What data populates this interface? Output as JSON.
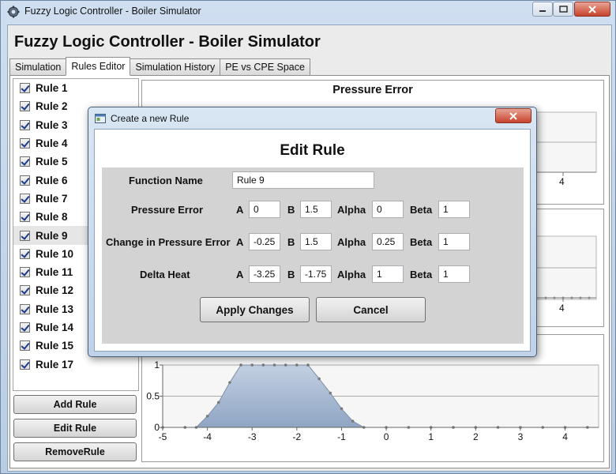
{
  "window": {
    "title": "Fuzzy Logic Controller - Boiler Simulator"
  },
  "app": {
    "header": "Fuzzy Logic Controller - Boiler Simulator"
  },
  "tabs": [
    {
      "label": "Simulation"
    },
    {
      "label": "Rules Editor"
    },
    {
      "label": "Simulation History"
    },
    {
      "label": "PE vs CPE Space"
    }
  ],
  "rules": [
    {
      "label": "Rule 1",
      "checked": true
    },
    {
      "label": "Rule 2",
      "checked": true
    },
    {
      "label": "Rule 3",
      "checked": true
    },
    {
      "label": "Rule 4",
      "checked": true
    },
    {
      "label": "Rule 5",
      "checked": true
    },
    {
      "label": "Rule 6",
      "checked": true
    },
    {
      "label": "Rule 7",
      "checked": true
    },
    {
      "label": "Rule 8",
      "checked": true
    },
    {
      "label": "Rule 9",
      "checked": true,
      "selected": true
    },
    {
      "label": "Rule 10",
      "checked": true
    },
    {
      "label": "Rule 11",
      "checked": true
    },
    {
      "label": "Rule 12",
      "checked": true
    },
    {
      "label": "Rule 13",
      "checked": true
    },
    {
      "label": "Rule 14",
      "checked": true
    },
    {
      "label": "Rule 15",
      "checked": true
    },
    {
      "label": "Rule 17",
      "checked": true
    }
  ],
  "buttons": {
    "add_rule": "Add Rule",
    "edit_rule": "Edit Rule",
    "remove_rule": "RemoveRule"
  },
  "charts": {
    "pressure_error": {
      "title": "Pressure Error",
      "visible_tick": "4"
    },
    "middle": {
      "visible_tick": "4"
    }
  },
  "chart_data": {
    "type": "area",
    "title": "",
    "x": [
      -5,
      -4.5,
      -4.25,
      -4,
      -3.75,
      -3.5,
      -3.25,
      -3,
      -2.75,
      -2.5,
      -2.25,
      -2,
      -1.75,
      -1.5,
      -1.25,
      -1,
      -0.75,
      -0.5,
      0,
      0.5,
      1,
      1.5,
      2,
      2.5,
      3,
      3.5,
      4,
      4.5
    ],
    "values": [
      0,
      0,
      0,
      0.18,
      0.4,
      0.72,
      1,
      1,
      1,
      1,
      1,
      1,
      1,
      0.78,
      0.55,
      0.3,
      0.1,
      0,
      0,
      0,
      0,
      0,
      0,
      0,
      0,
      0,
      0,
      0
    ],
    "xlim": [
      -5,
      4.75
    ],
    "ylim": [
      0,
      1
    ],
    "xticks": [
      "-5",
      "-4",
      "-3",
      "-2",
      "-1",
      "0",
      "1",
      "2",
      "3",
      "4"
    ],
    "yticks": [
      "0",
      "0.5",
      "1"
    ],
    "fill_color": "#8fa5c4",
    "grid": true
  },
  "dialog": {
    "window_title": "Create a new Rule",
    "heading": "Edit Rule",
    "function_name_label": "Function Name",
    "function_name_value": "Rule 9",
    "col_a": "A",
    "col_b": "B",
    "col_alpha": "Alpha",
    "col_beta": "Beta",
    "rows": [
      {
        "label": "Pressure Error",
        "a": "0",
        "b": "1.5",
        "alpha": "0",
        "beta": "1"
      },
      {
        "label": "Change in Pressure Error",
        "a": "-0.25",
        "b": "1.5",
        "alpha": "0.25",
        "beta": "1"
      },
      {
        "label": "Delta Heat",
        "a": "-3.25",
        "b": "-1.75",
        "alpha": "1",
        "beta": "1"
      }
    ],
    "apply_label": "Apply Changes",
    "cancel_label": "Cancel"
  }
}
